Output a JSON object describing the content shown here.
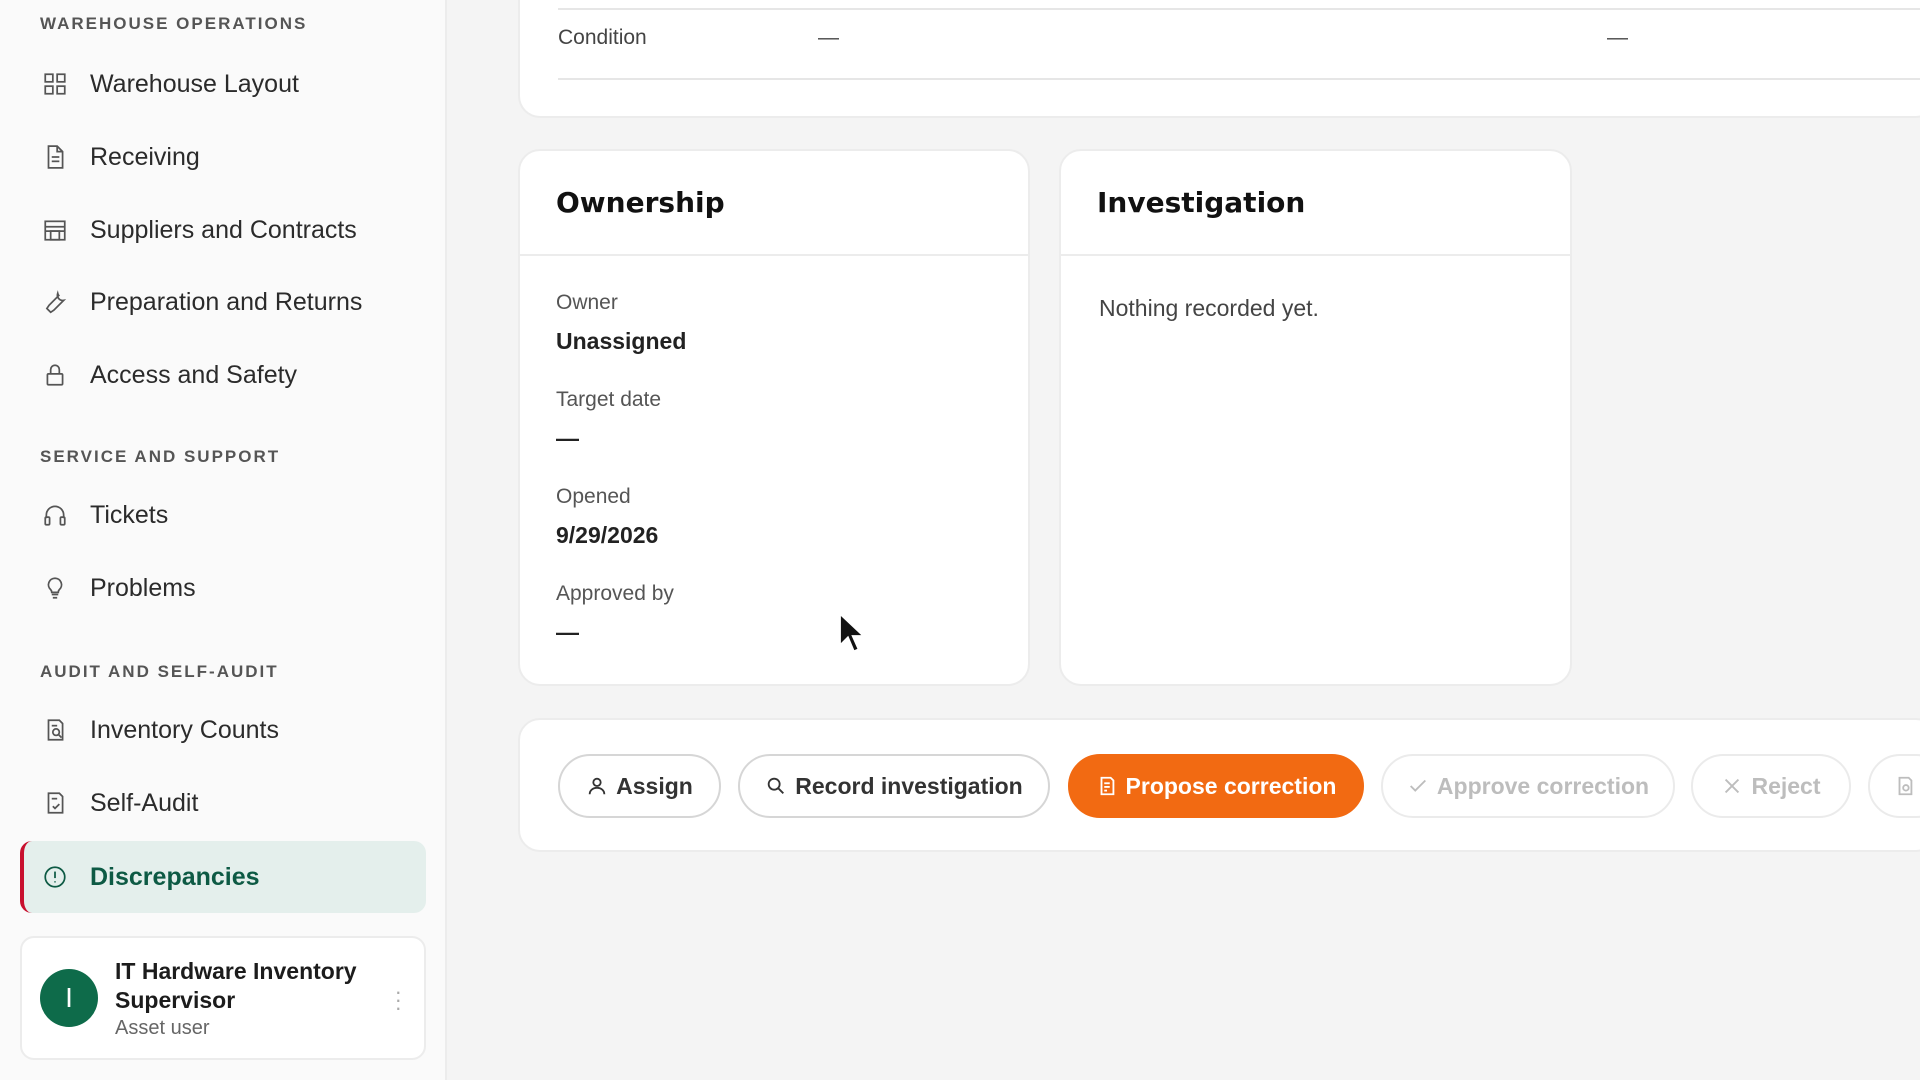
{
  "sidebar": {
    "sections": [
      {
        "title": "WAREHOUSE OPERATIONS",
        "items": [
          {
            "label": "Warehouse Layout",
            "icon": "grid-icon"
          },
          {
            "label": "Receiving",
            "icon": "document-icon"
          },
          {
            "label": "Suppliers and Contracts",
            "icon": "storefront-icon"
          },
          {
            "label": "Preparation and Returns",
            "icon": "wrench-icon"
          },
          {
            "label": "Access and Safety",
            "icon": "lock-icon"
          }
        ]
      },
      {
        "title": "SERVICE AND SUPPORT",
        "items": [
          {
            "label": "Tickets",
            "icon": "headset-icon"
          },
          {
            "label": "Problems",
            "icon": "lightbulb-icon"
          }
        ]
      },
      {
        "title": "AUDIT AND SELF-AUDIT",
        "items": [
          {
            "label": "Inventory Counts",
            "icon": "clipboard-search-icon"
          },
          {
            "label": "Self-Audit",
            "icon": "clipboard-check-icon"
          },
          {
            "label": "Discrepancies",
            "icon": "alert-circle-icon",
            "active": true
          }
        ]
      }
    ],
    "user": {
      "initial": "I",
      "name": "IT Hardware Inventory Supervisor",
      "role": "Asset user"
    }
  },
  "details": {
    "condition_label": "Condition",
    "condition_value_1": "—",
    "condition_value_2": "—"
  },
  "ownership": {
    "title": "Ownership",
    "owner_label": "Owner",
    "owner_value": "Unassigned",
    "target_date_label": "Target date",
    "target_date_value": "—",
    "opened_label": "Opened",
    "opened_value": "9/29/2026",
    "approved_by_label": "Approved by",
    "approved_by_value": "—"
  },
  "investigation": {
    "title": "Investigation",
    "empty_text": "Nothing recorded yet."
  },
  "actions": {
    "assign": "Assign",
    "record_investigation": "Record investigation",
    "propose_correction": "Propose correction",
    "approve_correction": "Approve correction",
    "reject": "Reject"
  },
  "colors": {
    "accent": "#f26a12",
    "active_nav_bg": "#e4efec",
    "active_nav_text": "#0d5a44",
    "active_nav_border": "#c8102e",
    "avatar_bg": "#0e6b4a"
  }
}
